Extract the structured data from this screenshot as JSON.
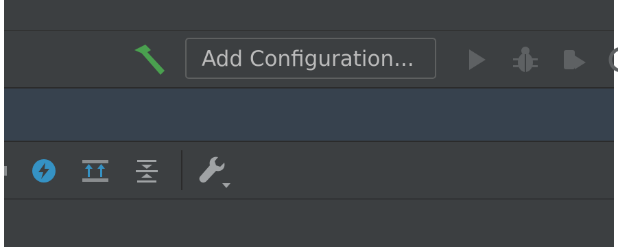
{
  "toolbar": {
    "build_icon": "hammer-icon",
    "run_configuration_label": "Add Configuration...",
    "run_icon": "play-icon",
    "debug_icon": "bug-icon",
    "coverage_icon": "coverage-icon",
    "profile_icon": "profiler-icon"
  },
  "tool_strip": {
    "icons": [
      "power-icon",
      "expand-all-icon",
      "collapse-all-icon",
      "wrench-icon"
    ]
  },
  "colors": {
    "background": "#3c3f41",
    "nav_bar": "#37424e",
    "build_green": "#4aa04f",
    "accent_blue": "#3592c4",
    "icon_gray": "#5e6163",
    "text": "#bbbbbb"
  }
}
